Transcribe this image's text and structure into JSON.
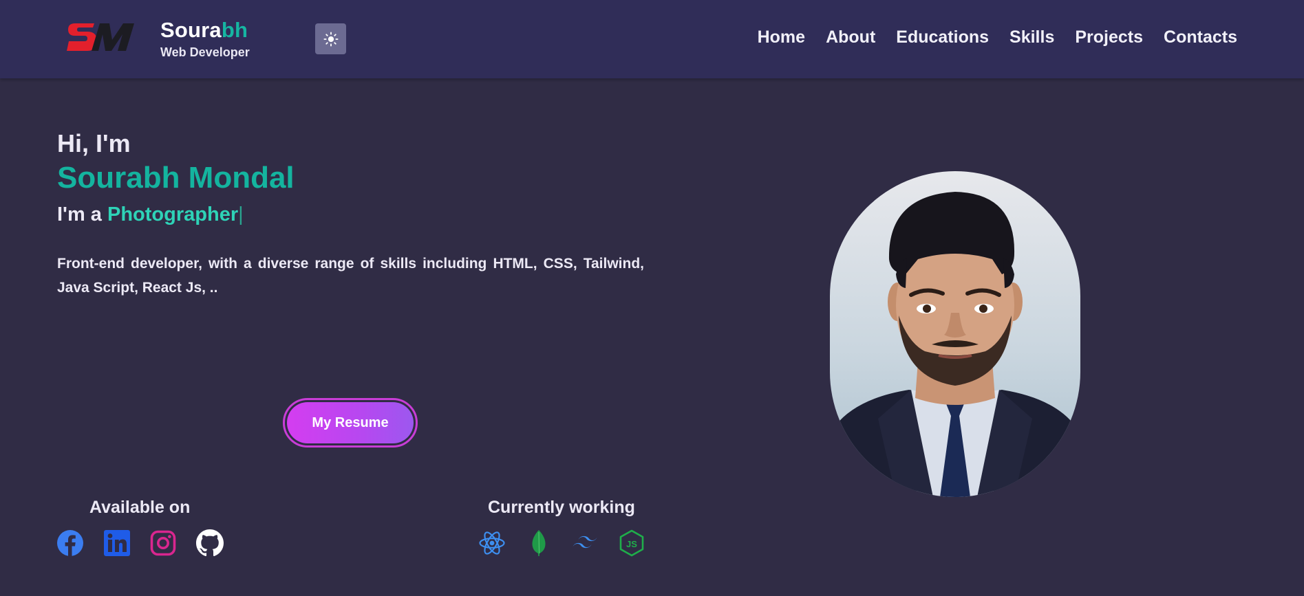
{
  "header": {
    "logo_text": "SM",
    "brand_first": "Soura",
    "brand_accent": "bh",
    "subtitle": "Web Developer",
    "theme_toggle_icon": "sun-icon",
    "nav": [
      "Home",
      "About",
      "Educations",
      "Skills",
      "Projects",
      "Contacts"
    ]
  },
  "hero": {
    "greeting": "Hi, I'm",
    "name": "Sourabh Mondal",
    "role_prefix": "I'm a",
    "role_word": "Photographer",
    "description": "Front-end developer, with a diverse range of skills including HTML, CSS, Tailwind, Java Script, React Js, ..",
    "resume_label": "My Resume"
  },
  "available": {
    "title": "Available on",
    "icons": [
      "facebook-icon",
      "linkedin-icon",
      "instagram-icon",
      "github-icon"
    ]
  },
  "working": {
    "title": "Currently working",
    "icons": [
      "react-icon",
      "mongodb-icon",
      "tailwind-icon",
      "nodejs-icon"
    ]
  },
  "colors": {
    "background": "#302c45",
    "header": "#302d58",
    "accent": "#14b49f",
    "button_gradient_start": "#d43df0",
    "button_gradient_end": "#9c58ef"
  }
}
